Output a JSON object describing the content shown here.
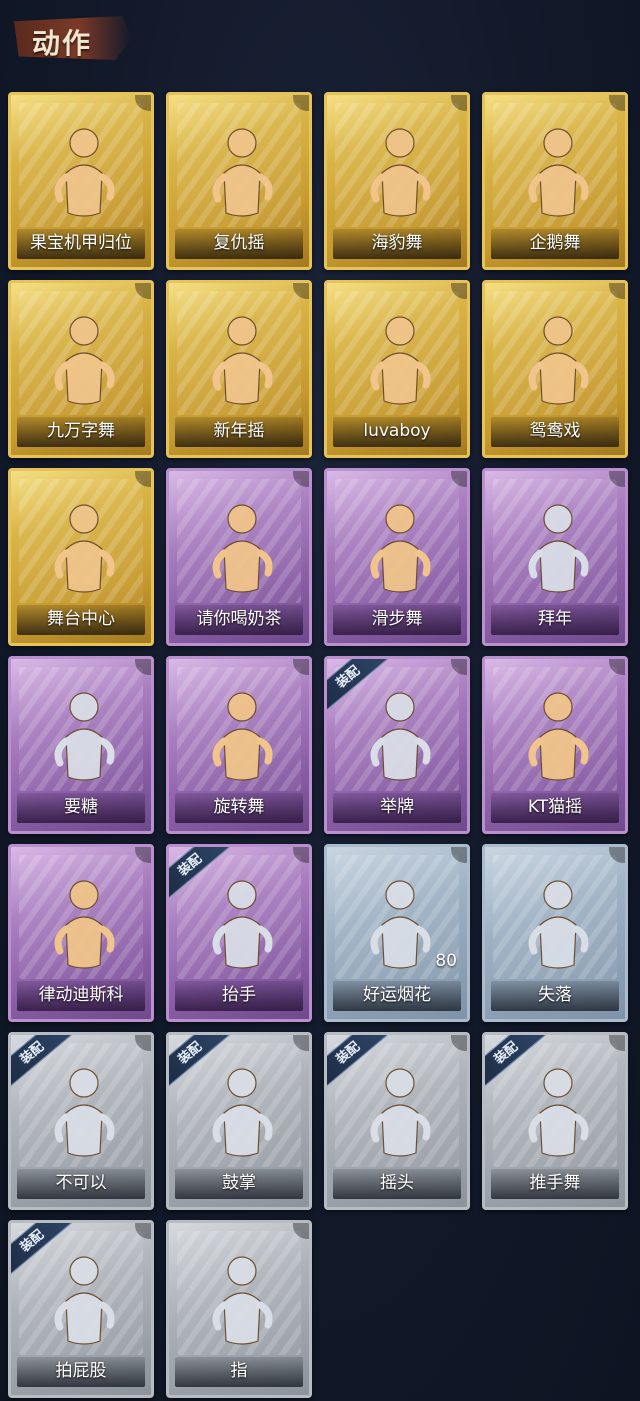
{
  "header": {
    "title": "动作"
  },
  "equipped_badge": "装配",
  "cards": [
    {
      "label": "果宝机甲归位",
      "tier": "gold",
      "equipped": false
    },
    {
      "label": "复仇摇",
      "tier": "gold",
      "equipped": false
    },
    {
      "label": "海豹舞",
      "tier": "gold",
      "equipped": false
    },
    {
      "label": "企鹅舞",
      "tier": "gold",
      "equipped": false
    },
    {
      "label": "九万字舞",
      "tier": "gold",
      "equipped": false
    },
    {
      "label": "新年摇",
      "tier": "gold",
      "equipped": false
    },
    {
      "label": "luvaboy",
      "tier": "gold",
      "equipped": false
    },
    {
      "label": "鸳鸯戏",
      "tier": "gold",
      "equipped": false
    },
    {
      "label": "舞台中心",
      "tier": "gold",
      "equipped": false
    },
    {
      "label": "请你喝奶茶",
      "tier": "purple",
      "equipped": false
    },
    {
      "label": "滑步舞",
      "tier": "purple",
      "equipped": false
    },
    {
      "label": "拜年",
      "tier": "purple",
      "equipped": false
    },
    {
      "label": "要糖",
      "tier": "purple",
      "equipped": false
    },
    {
      "label": "旋转舞",
      "tier": "purple",
      "equipped": false
    },
    {
      "label": "举牌",
      "tier": "purple",
      "equipped": true
    },
    {
      "label": "KT猫摇",
      "tier": "purple",
      "equipped": false
    },
    {
      "label": "律动迪斯科",
      "tier": "purple",
      "equipped": false
    },
    {
      "label": "抬手",
      "tier": "purple",
      "equipped": true
    },
    {
      "label": "好运烟花",
      "tier": "blue",
      "equipped": false,
      "count": "80"
    },
    {
      "label": "失落",
      "tier": "blue",
      "equipped": false
    },
    {
      "label": "不可以",
      "tier": "grey",
      "equipped": true
    },
    {
      "label": "鼓掌",
      "tier": "grey",
      "equipped": true
    },
    {
      "label": "摇头",
      "tier": "grey",
      "equipped": true
    },
    {
      "label": "推手舞",
      "tier": "grey",
      "equipped": true
    },
    {
      "label": "拍屁股",
      "tier": "grey",
      "equipped": true
    },
    {
      "label": "指",
      "tier": "grey",
      "equipped": false
    }
  ],
  "colors": {
    "background": "#121a2c",
    "gold": "#d9b447",
    "purple": "#a97fc0",
    "blue": "#9fb2c4",
    "grey": "#aeb3ba",
    "figure_gold": "#f0c48a",
    "figure_faded": "#d8dde6"
  }
}
